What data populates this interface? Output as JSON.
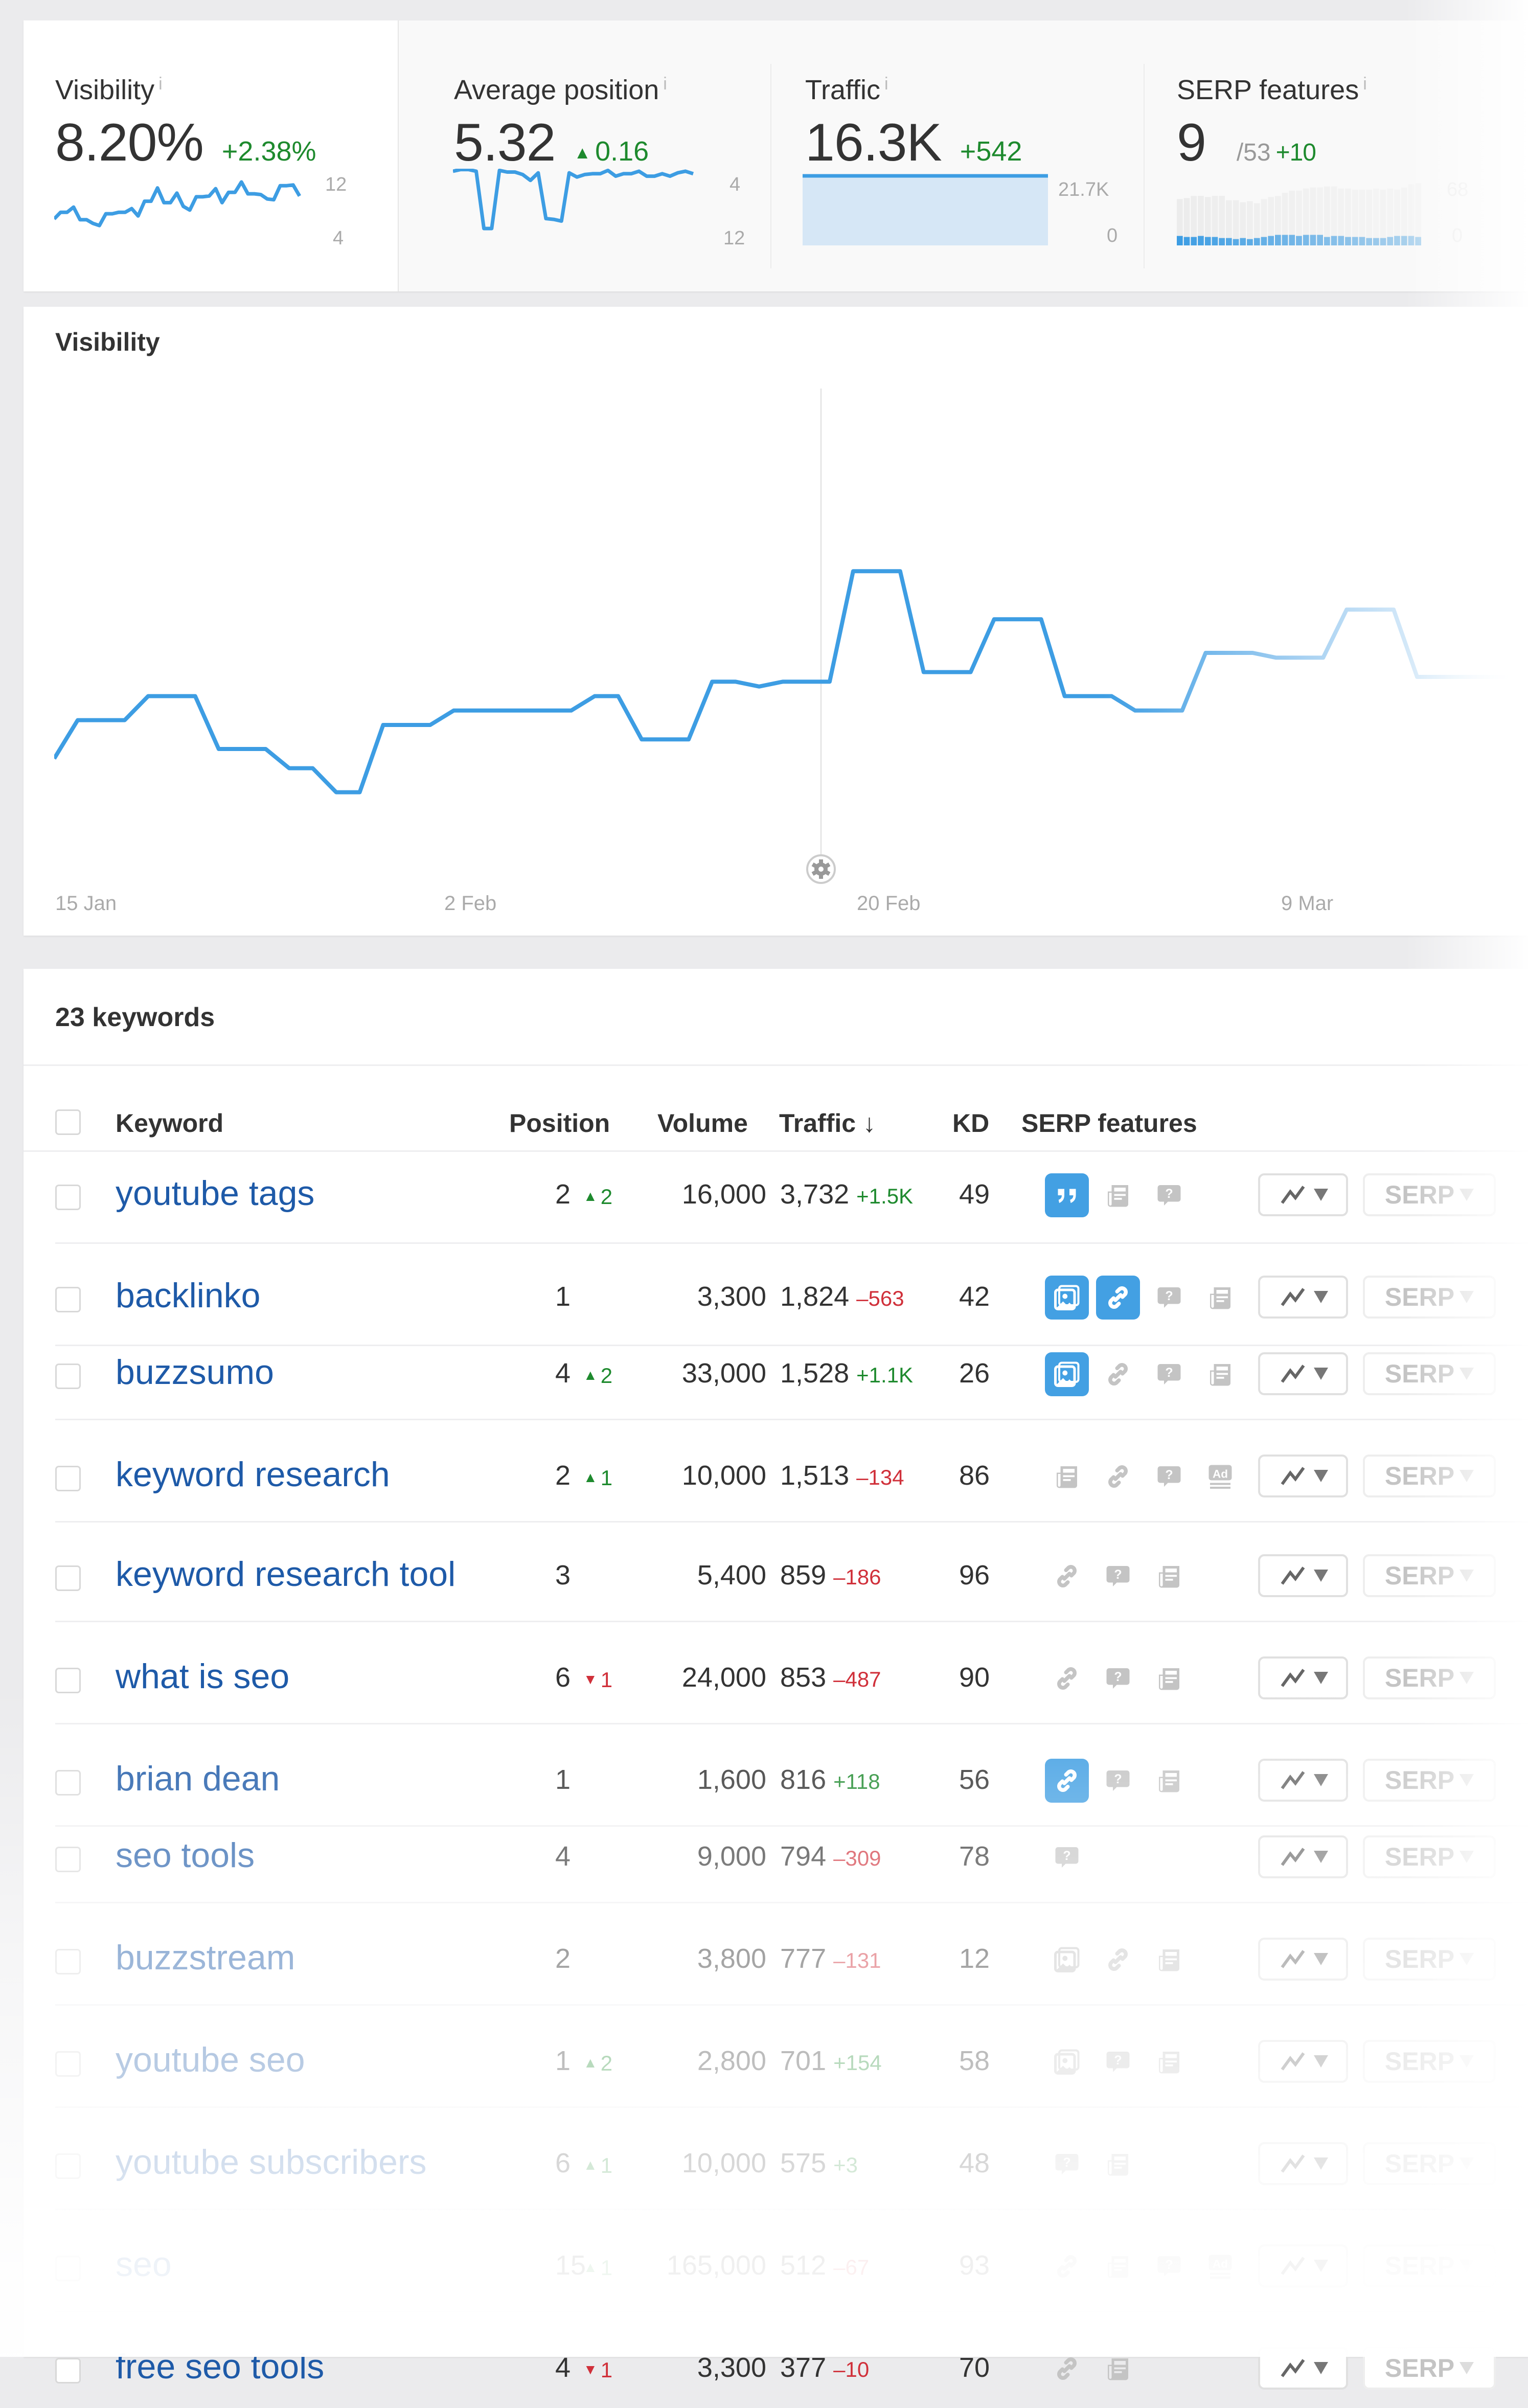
{
  "metrics": [
    {
      "label": "Visibility",
      "value": "8.20%",
      "delta": "+2.38%",
      "delta_dir": "up",
      "delta_arrow": false,
      "axis_top": "12",
      "axis_bottom": "4",
      "info_icon": "info-icon"
    },
    {
      "label": "Average position",
      "value": "5.32",
      "delta": "0.16",
      "delta_dir": "up",
      "delta_arrow": true,
      "axis_top": "4",
      "axis_bottom": "12",
      "info_icon": "info-icon"
    },
    {
      "label": "Traffic",
      "value": "16.3K",
      "delta": "+542",
      "delta_dir": "up",
      "delta_arrow": false,
      "axis_top": "21.7K",
      "axis_bottom": "0",
      "info_icon": "info-icon"
    },
    {
      "label": "SERP features",
      "value": "9",
      "sub": "/53",
      "delta": "+10",
      "delta_dir": "up",
      "delta_arrow": false,
      "axis_top": "68",
      "axis_bottom": "0",
      "info_icon": "info-icon"
    }
  ],
  "sparklines": {
    "visibility": [
      5.2,
      6.1,
      6.1,
      6.8,
      5.1,
      5.1,
      4.6,
      4.3,
      5.9,
      5.9,
      6.1,
      6.1,
      6.6,
      5.6,
      7.6,
      7.6,
      9.4,
      7.4,
      7.4,
      8.7,
      6.9,
      6.4,
      8.2,
      8.2,
      8.3,
      9.3,
      7.4,
      8.8,
      8.8,
      10.2,
      8.6,
      8.6,
      8.5,
      7.9,
      7.8,
      9.7,
      9.7,
      9.8,
      8.3
    ],
    "avg_position": [
      4.3,
      4.1,
      4.1,
      4.3,
      11.2,
      11.2,
      4.2,
      4.4,
      4.4,
      4.7,
      5.4,
      4.5,
      10.0,
      10.1,
      10.3,
      4.5,
      5.0,
      4.7,
      4.6,
      4.6,
      4.2,
      4.9,
      4.6,
      4.6,
      4.3,
      4.9,
      4.9,
      4.6,
      4.9,
      4.5,
      4.3,
      4.6
    ],
    "traffic": [
      18.5,
      20.2,
      19.0,
      17.8,
      17.6,
      19.3,
      19.3,
      16.0,
      16.1,
      14.8,
      16.6,
      16.8,
      19.9,
      17.0,
      18.9,
      16.0,
      15.6,
      17.6,
      17.8,
      19.3,
      17.7,
      19.3,
      21.5,
      18.8,
      18.3,
      17.2,
      17.8,
      20.9,
      20.3,
      18.0
    ],
    "serp_total": [
      44,
      45,
      47,
      47,
      46,
      47,
      47,
      43,
      43,
      41,
      42,
      40,
      44,
      46,
      47,
      50,
      52,
      52,
      54,
      55,
      55,
      56,
      56,
      54,
      54,
      53,
      53,
      53,
      54,
      53,
      54,
      53,
      55,
      58,
      59
    ],
    "serp_owned": [
      9,
      8,
      8,
      9,
      8,
      8,
      7,
      7,
      6,
      7,
      6,
      7,
      8,
      9,
      10,
      10,
      10,
      9,
      10,
      10,
      10,
      8,
      9,
      9,
      8,
      8,
      8,
      7,
      7,
      7,
      8,
      9,
      9,
      9,
      8
    ]
  },
  "chart_data": {
    "type": "line",
    "title": "Visibility",
    "xlabel": "",
    "ylabel": "",
    "x_tick_labels": [
      "15 Jan",
      "2 Feb",
      "20 Feb",
      "9 Mar"
    ],
    "grid": true,
    "ylim": [
      0,
      10
    ],
    "series": [
      {
        "name": "Visibility",
        "color": "#3d9de3",
        "x": [
          0,
          1,
          2,
          3,
          4,
          5,
          6,
          7,
          8,
          9,
          10,
          11,
          12,
          13,
          14,
          15,
          16,
          17,
          18,
          19,
          20,
          21,
          22,
          23,
          24,
          25,
          26,
          27,
          28,
          29,
          30,
          31,
          32,
          33,
          34,
          35,
          36,
          37,
          38,
          39,
          40,
          41,
          42,
          43,
          44,
          45,
          46,
          47,
          48,
          49,
          50,
          51,
          52,
          53,
          54,
          55,
          56,
          57,
          58,
          59,
          60,
          61,
          62
        ],
        "values": [
          2.3,
          3.1,
          3.1,
          3.1,
          3.6,
          3.6,
          3.6,
          2.5,
          2.5,
          2.5,
          2.1,
          2.1,
          1.6,
          1.6,
          3.0,
          3.0,
          3.0,
          3.3,
          3.3,
          3.3,
          3.3,
          3.3,
          3.3,
          3.6,
          3.6,
          2.7,
          2.7,
          2.7,
          3.9,
          3.9,
          3.8,
          3.9,
          3.9,
          3.9,
          6.2,
          6.2,
          6.2,
          4.1,
          4.1,
          4.1,
          5.2,
          5.2,
          5.2,
          3.6,
          3.6,
          3.6,
          3.3,
          3.3,
          3.3,
          4.5,
          4.5,
          4.5,
          4.4,
          4.4,
          4.4,
          5.4,
          5.4,
          5.4,
          4.0,
          4.0,
          4.0,
          4.0,
          4.0
        ]
      }
    ],
    "crosshair_label": "settings",
    "legend": "none"
  },
  "chart_icons": {
    "settings": "gear-icon"
  },
  "keywords": {
    "count_label": "23 keywords",
    "headers": {
      "keyword": "Keyword",
      "position": "Position",
      "volume": "Volume",
      "traffic": "Traffic",
      "traffic_sort": "↓",
      "kd": "KD",
      "serp": "SERP features"
    },
    "chart_button_icon": "trend-chart-icon",
    "serp_button_label": "SERP",
    "rows": [
      {
        "keyword": "youtube tags",
        "position": "2",
        "pos_delta": "2",
        "pos_dir": "up",
        "volume": "16,000",
        "traffic": "3,732",
        "traffic_delta": "+1.5K",
        "traffic_dir": "up",
        "kd": "49",
        "features": [
          {
            "type": "quote",
            "on": true
          },
          {
            "type": "news",
            "on": false
          },
          {
            "type": "question",
            "on": false
          }
        ]
      },
      {
        "keyword": "backlinko",
        "position": "1",
        "pos_delta": "",
        "pos_dir": "",
        "volume": "3,300",
        "traffic": "1,824",
        "traffic_delta": "–563",
        "traffic_dir": "down",
        "kd": "42",
        "features": [
          {
            "type": "image",
            "on": true
          },
          {
            "type": "link",
            "on": true
          },
          {
            "type": "question",
            "on": false
          },
          {
            "type": "news",
            "on": false
          }
        ]
      },
      {
        "keyword": "buzzsumo",
        "position": "4",
        "pos_delta": "2",
        "pos_dir": "up",
        "volume": "33,000",
        "traffic": "1,528",
        "traffic_delta": "+1.1K",
        "traffic_dir": "up",
        "kd": "26",
        "features": [
          {
            "type": "image",
            "on": true
          },
          {
            "type": "link",
            "on": false
          },
          {
            "type": "question",
            "on": false
          },
          {
            "type": "news",
            "on": false
          }
        ]
      },
      {
        "keyword": "keyword research",
        "position": "2",
        "pos_delta": "1",
        "pos_dir": "up",
        "volume": "10,000",
        "traffic": "1,513",
        "traffic_delta": "–134",
        "traffic_dir": "down",
        "kd": "86",
        "features": [
          {
            "type": "news",
            "on": false
          },
          {
            "type": "link",
            "on": false
          },
          {
            "type": "question",
            "on": false
          },
          {
            "type": "ad",
            "on": false
          }
        ]
      },
      {
        "keyword": "keyword research tool",
        "position": "3",
        "pos_delta": "",
        "pos_dir": "",
        "volume": "5,400",
        "traffic": "859",
        "traffic_delta": "–186",
        "traffic_dir": "down",
        "kd": "96",
        "features": [
          {
            "type": "link",
            "on": false
          },
          {
            "type": "question",
            "on": false
          },
          {
            "type": "news",
            "on": false
          }
        ]
      },
      {
        "keyword": "what is seo",
        "position": "6",
        "pos_delta": "1",
        "pos_dir": "down",
        "volume": "24,000",
        "traffic": "853",
        "traffic_delta": "–487",
        "traffic_dir": "down",
        "kd": "90",
        "features": [
          {
            "type": "link",
            "on": false
          },
          {
            "type": "question",
            "on": false
          },
          {
            "type": "news",
            "on": false
          }
        ]
      },
      {
        "keyword": "brian dean",
        "position": "1",
        "pos_delta": "",
        "pos_dir": "",
        "volume": "1,600",
        "traffic": "816",
        "traffic_delta": "+118",
        "traffic_dir": "up",
        "kd": "56",
        "features": [
          {
            "type": "link",
            "on": true
          },
          {
            "type": "question",
            "on": false
          },
          {
            "type": "news",
            "on": false
          }
        ]
      },
      {
        "keyword": "seo tools",
        "position": "4",
        "pos_delta": "",
        "pos_dir": "",
        "volume": "9,000",
        "traffic": "794",
        "traffic_delta": "–309",
        "traffic_dir": "down",
        "kd": "78",
        "features": [
          {
            "type": "question",
            "on": false
          }
        ]
      },
      {
        "keyword": "buzzstream",
        "position": "2",
        "pos_delta": "",
        "pos_dir": "",
        "volume": "3,800",
        "traffic": "777",
        "traffic_delta": "–131",
        "traffic_dir": "down",
        "kd": "12",
        "features": [
          {
            "type": "image",
            "on": false
          },
          {
            "type": "link",
            "on": false
          },
          {
            "type": "news",
            "on": false
          }
        ]
      },
      {
        "keyword": "youtube seo",
        "position": "1",
        "pos_delta": "2",
        "pos_dir": "up",
        "volume": "2,800",
        "traffic": "701",
        "traffic_delta": "+154",
        "traffic_dir": "up",
        "kd": "58",
        "features": [
          {
            "type": "image",
            "on": false
          },
          {
            "type": "question",
            "on": false
          },
          {
            "type": "news",
            "on": false
          }
        ]
      },
      {
        "keyword": "youtube subscribers",
        "position": "6",
        "pos_delta": "1",
        "pos_dir": "up",
        "volume": "10,000",
        "traffic": "575",
        "traffic_delta": "+3",
        "traffic_dir": "up",
        "kd": "48",
        "features": [
          {
            "type": "question",
            "on": false
          },
          {
            "type": "news",
            "on": false
          }
        ]
      },
      {
        "keyword": "seo",
        "position": "15",
        "pos_delta": "1",
        "pos_dir": "up",
        "volume": "165,000",
        "traffic": "512",
        "traffic_delta": "–67",
        "traffic_dir": "down",
        "kd": "93",
        "features": [
          {
            "type": "link",
            "on": false
          },
          {
            "type": "news",
            "on": false
          },
          {
            "type": "question",
            "on": false
          },
          {
            "type": "ad",
            "on": false
          }
        ]
      },
      {
        "keyword": "free seo tools",
        "position": "4",
        "pos_delta": "1",
        "pos_dir": "down",
        "volume": "3,300",
        "traffic": "377",
        "traffic_delta": "–10",
        "traffic_dir": "down",
        "kd": "70",
        "features": [
          {
            "type": "link",
            "on": false
          },
          {
            "type": "news",
            "on": false
          }
        ]
      }
    ]
  },
  "colors": {
    "accent": "#3d9de3",
    "link": "#1e5aa8",
    "positive": "#1e8a2e",
    "negative": "#d0303a",
    "feature_on": "#43a0e3",
    "feature_off": "#c4c4c4"
  }
}
